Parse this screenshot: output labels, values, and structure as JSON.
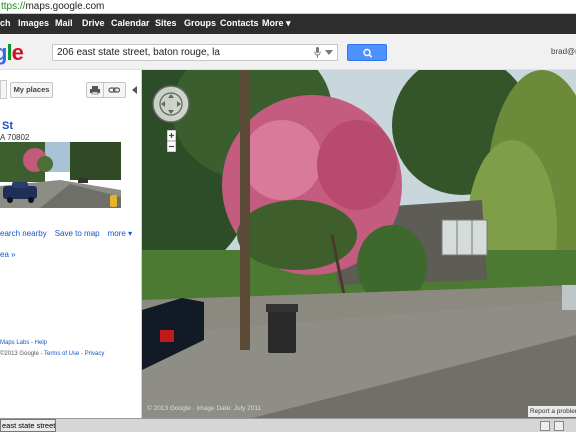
{
  "browser": {
    "url_scheme": "ttps://",
    "url_host": "maps.google.com"
  },
  "gbar": {
    "items": [
      "ch",
      "Images",
      "Mail",
      "Drive",
      "Calendar",
      "Sites",
      "Groups",
      "Contacts",
      "More ▾"
    ]
  },
  "header": {
    "logo": "gle",
    "search_value": "206 east state street, baton rouge, la",
    "user": "brad@r"
  },
  "left_panel": {
    "my_places": "My places",
    "place_title": "St",
    "place_address": "A 70802",
    "links": [
      "earch nearby",
      "Save to map",
      "more ▾"
    ],
    "area_link": "ea »",
    "footer_line1": "Maps Labs - Help",
    "footer_line2_prefix": "©2013 Google - ",
    "footer_terms": "Terms of Use",
    "footer_sep": " - ",
    "footer_privacy": "Privacy"
  },
  "map": {
    "copyright": "© 2013 Google · Image Date: July 2011",
    "report": "Report a problem"
  },
  "taskbar": {
    "item": "east state street,..."
  },
  "colors": {
    "gbar_bg": "#2d2d2d",
    "search_blue": "#4d90fe",
    "link_blue": "#1155cc"
  }
}
